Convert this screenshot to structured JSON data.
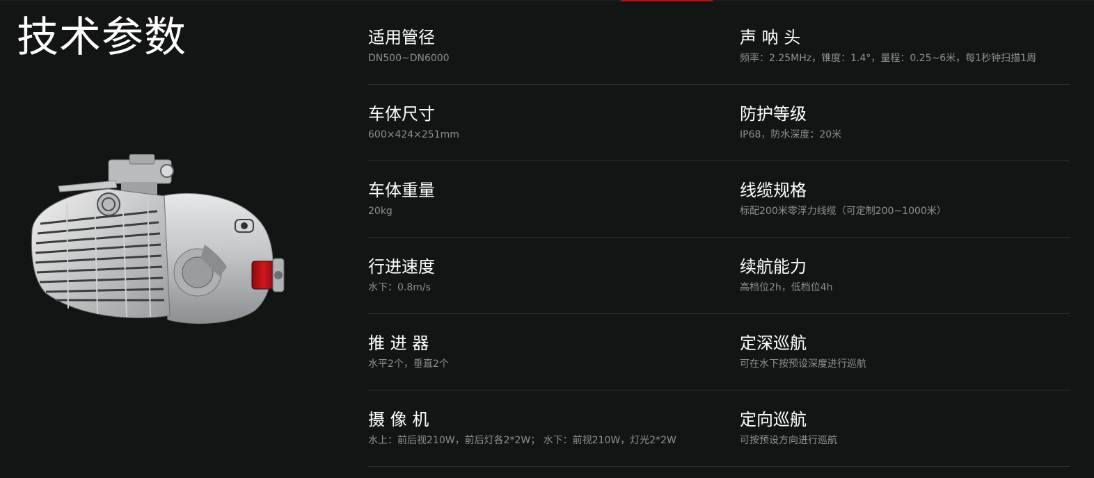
{
  "page": {
    "title": "技术参数",
    "accent_color": "#c00d12",
    "background_color": "#131515"
  },
  "product_image": {
    "icon": "underwater-pipe-robot-image"
  },
  "specs": {
    "rows": [
      {
        "left": {
          "label": "适用管径",
          "value": "DN500~DN6000"
        },
        "right": {
          "label": "声 呐 头",
          "value": "频率：2.25MHz，锥度：1.4°，量程：0.25~6米，每1秒钟扫描1周"
        }
      },
      {
        "left": {
          "label": "车体尺寸",
          "value": "600×424×251mm"
        },
        "right": {
          "label": "防护等级",
          "value": "IP68，防水深度：20米"
        }
      },
      {
        "left": {
          "label": "车体重量",
          "value": "20kg"
        },
        "right": {
          "label": "线缆规格",
          "value": "标配200米零浮力线缆（可定制200~1000米）"
        }
      },
      {
        "left": {
          "label": "行进速度",
          "value": "水下：0.8m/s"
        },
        "right": {
          "label": "续航能力",
          "value": "高档位2h，低档位4h"
        }
      },
      {
        "left": {
          "label": "推 进 器",
          "value": "水平2个，垂直2个"
        },
        "right": {
          "label": "定深巡航",
          "value": "可在水下按预设深度进行巡航"
        }
      },
      {
        "left": {
          "label": "摄 像 机",
          "value": "水上：前后视210W，前后灯各2*2W；  水下：前视210W，灯光2*2W"
        },
        "right": {
          "label": "定向巡航",
          "value": "可按预设方向进行巡航"
        }
      }
    ]
  }
}
